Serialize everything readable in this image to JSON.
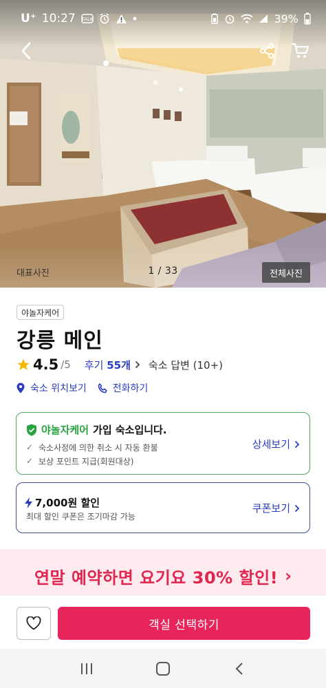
{
  "status_bar": {
    "carrier": "U⁺",
    "time": "10:27",
    "battery": "39%"
  },
  "icons": {
    "back": "chevron-left-icon",
    "share": "share-icon",
    "cart": "cart-icon",
    "star": "star-icon",
    "location": "location-pin-icon",
    "phone": "phone-icon",
    "shield": "shield-check-icon",
    "bolt": "lightning-icon",
    "heart": "heart-icon"
  },
  "hero": {
    "label": "대표사진",
    "counter": "1 / 33",
    "all_photos": "전체사진"
  },
  "hotel": {
    "brand_badge": "야놀자케어",
    "name": "강릉 메인",
    "rating": "4.5",
    "rating_max": "/5",
    "review_label": "후기",
    "review_count": "55개",
    "host_reply": "숙소 답변 (10+)"
  },
  "actions": {
    "location": "숙소 위치보기",
    "phone": "전화하기"
  },
  "member_card": {
    "brand": "야놀자케어",
    "title_rest": "가입 숙소입니다.",
    "items": [
      "숙소사정에 의한 취소 시 자동 환불",
      "보상 포인트 지급(회원대상)"
    ],
    "link": "상세보기"
  },
  "coupon_card": {
    "title": "7,000원 할인",
    "subtitle": "최대 할인 쿠폰은 조기마감 가능",
    "link": "쿠폰보기"
  },
  "promo": {
    "text": "연말 예약하면 요기요 30% 할인!"
  },
  "bottom": {
    "reserve": "객실 선택하기"
  },
  "colors": {
    "accent_blue": "#2a3dbf",
    "care_green": "#27a340",
    "reserve_pink": "#e8245d",
    "promo_red": "#e0264f",
    "promo_bg": "#fdebef"
  }
}
